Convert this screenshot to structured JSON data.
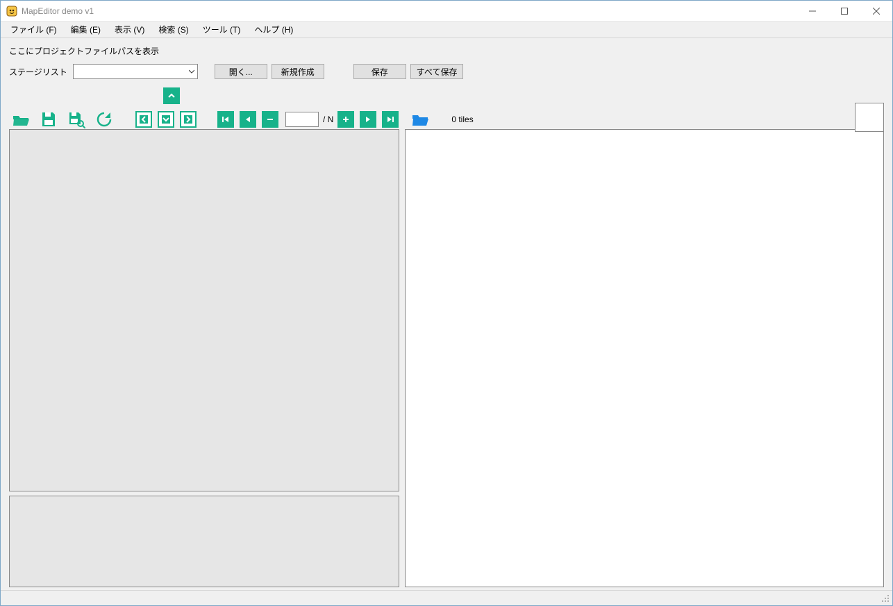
{
  "window": {
    "title": "MapEditor demo v1"
  },
  "menu": {
    "file": "ファイル (F)",
    "edit": "編集 (E)",
    "view": "表示 (V)",
    "search": "検索 (S)",
    "tool": "ツール (T)",
    "help": "ヘルプ (H)"
  },
  "project": {
    "path_label": "ここにプロジェクトファイルパスを表示",
    "stage_list_label": "ステージリスト",
    "stage_selected": "",
    "open_btn": "開く...",
    "new_btn": "新規作成",
    "save_btn": "保存",
    "save_all_btn": "すべて保存"
  },
  "toolbar": {
    "frame_value": "",
    "over_n": "/ N",
    "tiles_label": "0 tiles"
  }
}
